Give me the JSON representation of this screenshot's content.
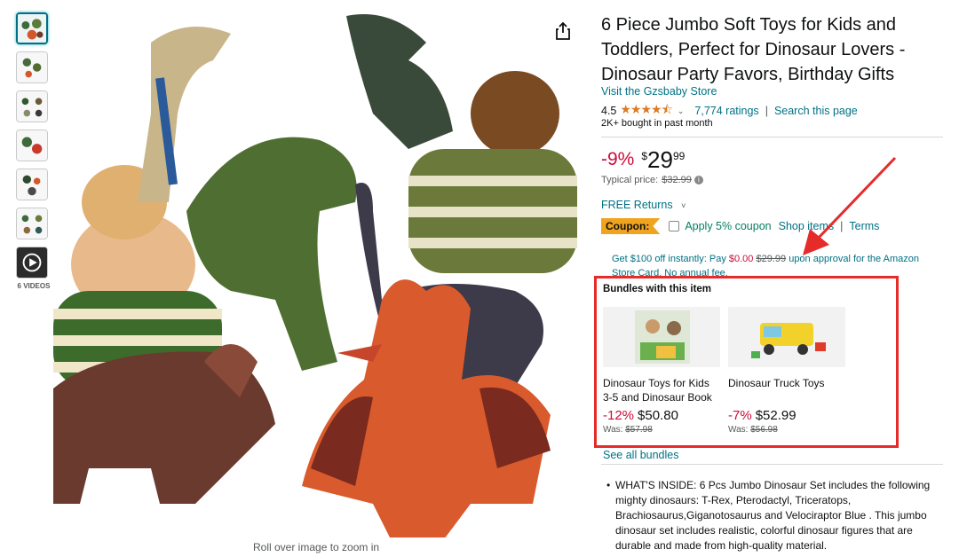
{
  "gallery": {
    "video_label": "6 VIDEOS",
    "zoom_hint": "Roll over image to zoom in"
  },
  "product": {
    "title": "6 Piece Jumbo Soft Toys for Kids and Toddlers, Perfect for Dinosaur Lovers - Dinosaur Party Favors, Birthday Gifts",
    "store_link": "Visit the Gzsbaby Store",
    "rating_value": "4.5",
    "stars": "★★★★⯪",
    "ratings_count": "7,774 ratings",
    "separator": "|",
    "search_page": "Search this page",
    "bought": "2K+ bought in past month"
  },
  "price": {
    "discount": "-9%",
    "currency": "$",
    "whole": "29",
    "fraction": "99",
    "typical_label": "Typical price:",
    "typical_value": "$32.99"
  },
  "returns": {
    "label": "FREE Returns",
    "chevron": "˅"
  },
  "coupon": {
    "tag": "Coupon:",
    "text": "Apply 5% coupon",
    "shop_items": "Shop items",
    "separator": "|",
    "terms": "Terms"
  },
  "card_offer": {
    "part1": "Get $100 off instantly: Pay ",
    "pay": "$0.00",
    "space": " ",
    "strike": "$29.99",
    "part2": " upon approval for the Amazon Store Card. No annual fee."
  },
  "bundles": {
    "title": "Bundles with this item",
    "items": [
      {
        "name": "Dinosaur Toys for Kids 3-5 and Dinosaur Book",
        "discount": "-12%",
        "price": "$50.80",
        "was_label": "Was:",
        "was_price": "$57.98"
      },
      {
        "name": "Dinosaur Truck Toys",
        "discount": "-7%",
        "price": "$52.99",
        "was_label": "Was:",
        "was_price": "$56.98"
      }
    ],
    "see_all": "See all bundles"
  },
  "bullets": [
    "WHAT'S INSIDE: 6 Pcs Jumbo Dinosaur Set includes the following mighty dinosaurs: T-Rex, Pterodactyl, Triceratops, Brachiosaurus,Giganotosaurus and Velociraptor Blue . This jumbo dinosaur set includes realistic, colorful dinosaur figures that are durable and made from high-quality material."
  ],
  "colors": {
    "link": "#007185",
    "deal_red": "#cc0c39",
    "star": "#de7921",
    "coupon_tag": "#f0a31e",
    "coupon_green": "#067d62",
    "annotation_red": "#e62b2b"
  }
}
